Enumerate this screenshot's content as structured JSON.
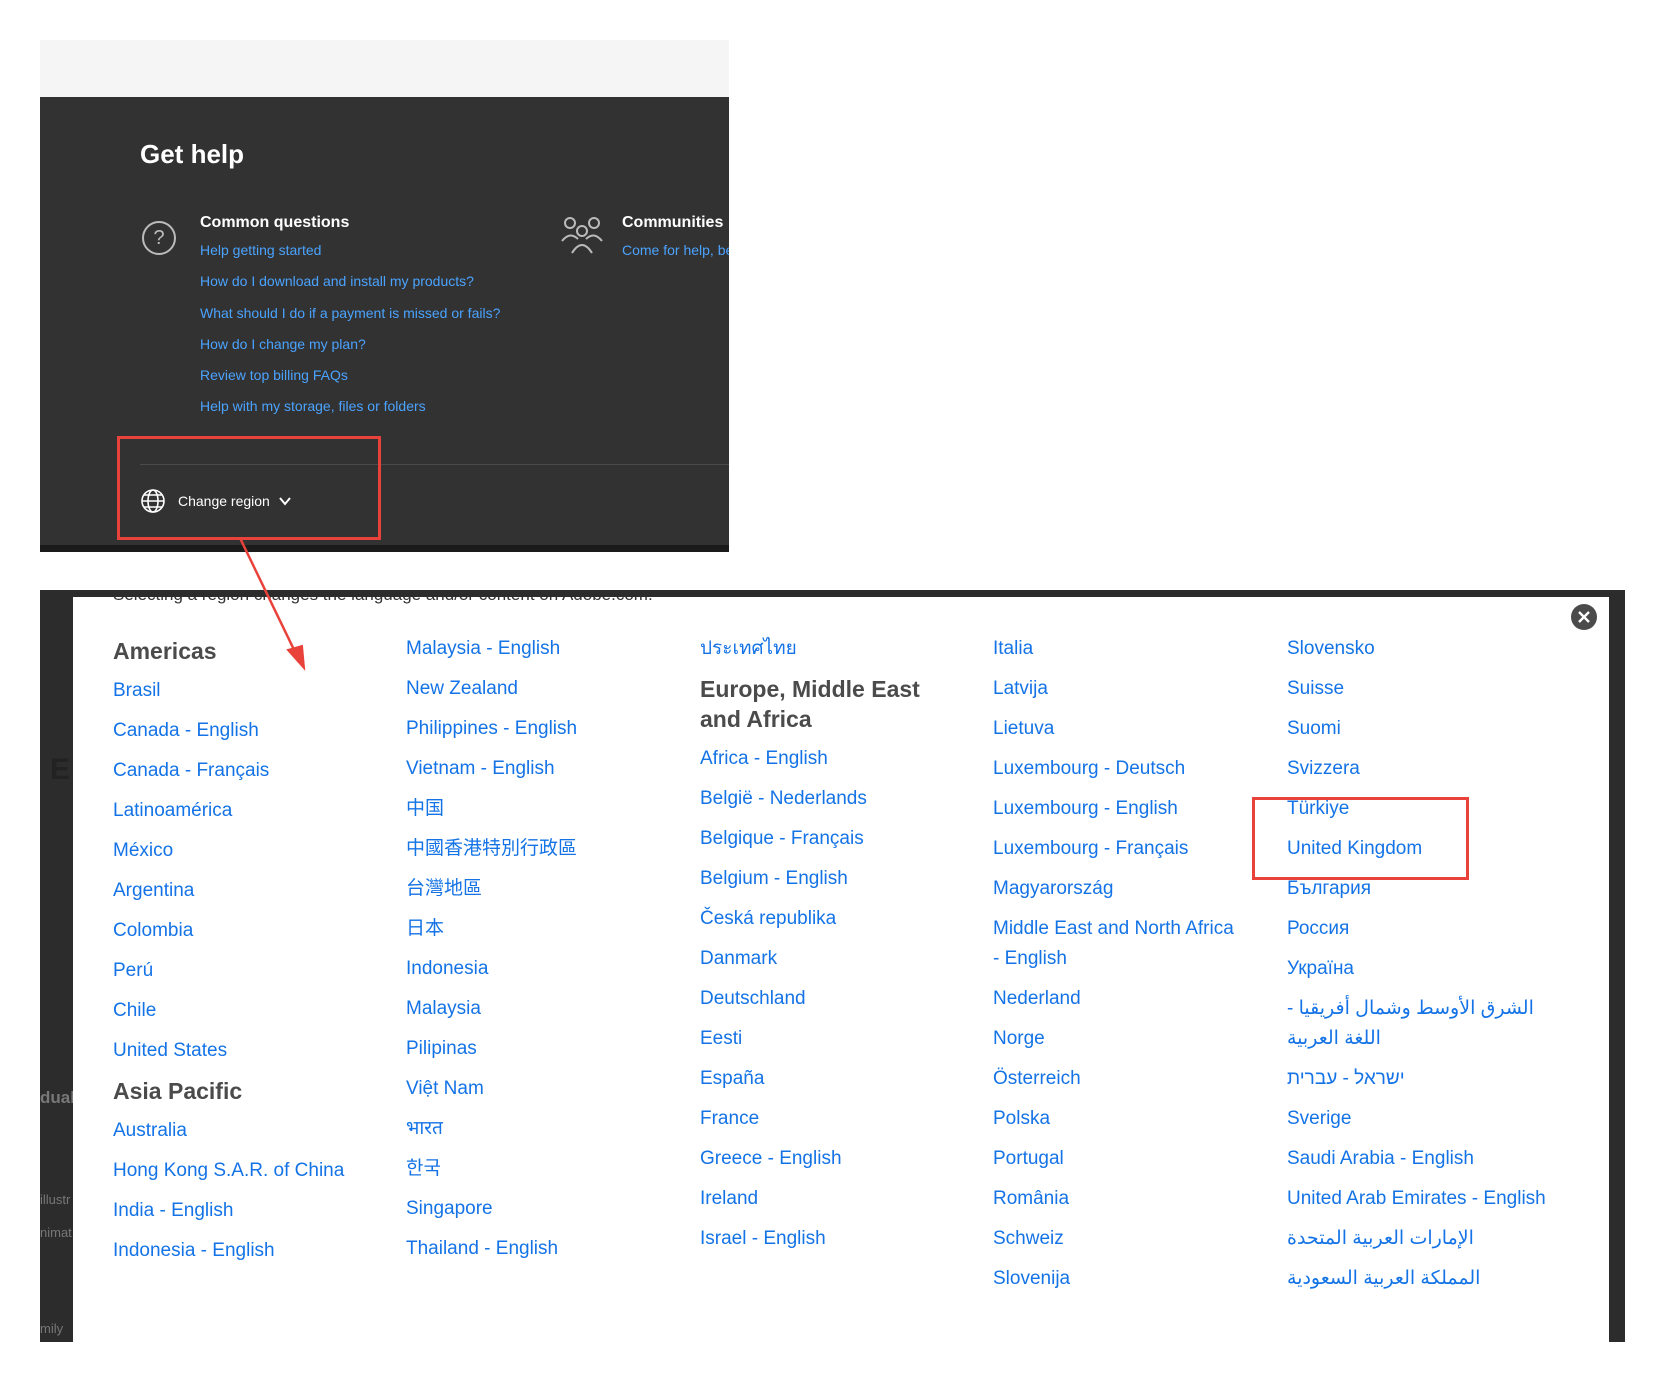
{
  "help_panel": {
    "title": "Get help",
    "common_questions": {
      "title": "Common questions",
      "links": [
        "Help getting started",
        "How do I download and install my products?",
        "What should I do if a payment is missed or fails?",
        "How do I change my plan?",
        "Review top billing FAQs",
        "Help with my storage, files or folders"
      ]
    },
    "communities": {
      "title": "Communities",
      "link": "Come for help, be"
    },
    "change_region_label": "Change region"
  },
  "region_modal": {
    "subtext": "Selecting a region changes the language and/or content on Adobe.com.",
    "columns": [
      {
        "groups": [
          {
            "heading": "Americas",
            "items": [
              "Brasil",
              "Canada - English",
              "Canada - Français",
              "Latinoamérica",
              "México",
              "Argentina",
              "Colombia",
              "Perú",
              "Chile",
              "United States"
            ]
          },
          {
            "heading": "Asia Pacific",
            "items": [
              "Australia",
              "Hong Kong S.A.R. of China",
              "India - English",
              "Indonesia - English"
            ]
          }
        ]
      },
      {
        "groups": [
          {
            "heading": "",
            "items": [
              "Malaysia - English",
              "New Zealand",
              "Philippines - English",
              "Vietnam - English",
              "中国",
              "中國香港特別行政區",
              "台灣地區",
              "日本",
              "Indonesia",
              "Malaysia",
              "Pilipinas",
              "Việt Nam",
              "भारत",
              "한국",
              "Singapore",
              "Thailand - English"
            ]
          }
        ]
      },
      {
        "groups": [
          {
            "heading": "",
            "items": [
              "ประเทศไทย"
            ]
          },
          {
            "heading": "Europe, Middle East and Africa",
            "items": [
              "Africa - English",
              "België - Nederlands",
              "Belgique - Français",
              "Belgium - English",
              "Česká republika",
              "Danmark",
              "Deutschland",
              "Eesti",
              "España",
              "France",
              "Greece - English",
              "Ireland",
              "Israel - English"
            ]
          }
        ]
      },
      {
        "groups": [
          {
            "heading": "",
            "items": [
              "Italia",
              "Latvija",
              "Lietuva",
              "Luxembourg - Deutsch",
              "Luxembourg - English",
              "Luxembourg - Français",
              "Magyarország",
              "Middle East and North Africa - English",
              "Nederland",
              "Norge",
              "Österreich",
              "Polska",
              "Portugal",
              "România",
              "Schweiz",
              "Slovenija"
            ]
          }
        ]
      },
      {
        "groups": [
          {
            "heading": "",
            "items": [
              "Slovensko",
              "Suisse",
              "Suomi",
              "Svizzera",
              "Türkiye",
              "United Kingdom",
              "България",
              "Россия",
              "Україна",
              "الشرق الأوسط وشمال أفريقيا - اللغة العربية",
              "ישראל - עברית",
              "Sverige",
              "Saudi Arabia - English",
              "United Arab Emirates - English",
              "الإمارات العربية المتحدة",
              "المملكة العربية السعودية"
            ]
          }
        ]
      }
    ]
  },
  "background_fragments": [
    "E",
    "dual",
    "illustr",
    "nimat",
    "mily"
  ],
  "colors": {
    "panel_bg": "#323232",
    "link_blue_dark": "#4aa3ff",
    "link_blue": "#1473e6",
    "heading": "#4b4b4b",
    "highlight_red": "#e8423a"
  },
  "icons": [
    "question-icon",
    "communities-icon",
    "globe-icon",
    "chevron-down-icon",
    "close-icon",
    "annotation-arrow"
  ]
}
